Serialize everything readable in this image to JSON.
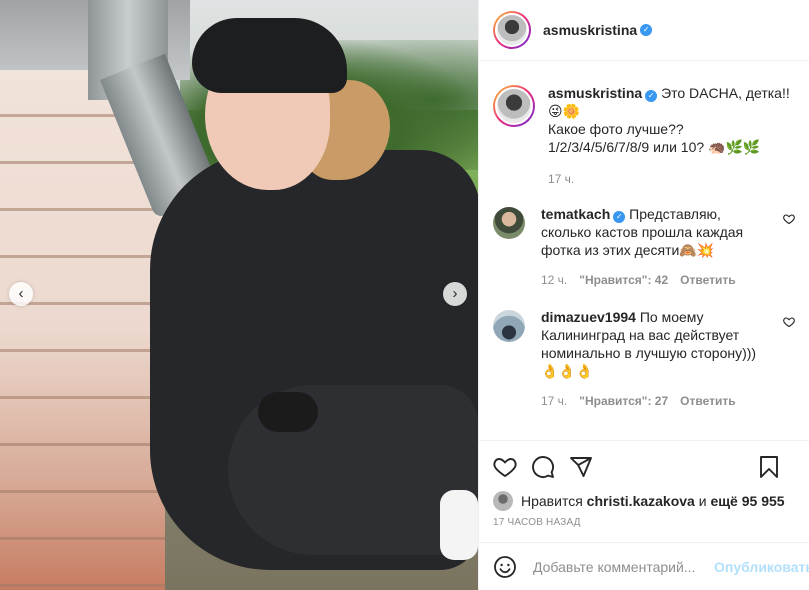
{
  "post": {
    "author": "asmuskristina",
    "verified_mark": "✓"
  },
  "caption": {
    "username": "asmuskristina",
    "line1": "Это DACHA, детка!! 😜🌼",
    "line2": "Какое фото лучше??",
    "line3": "1/2/3/4/5/6/7/8/9 или 10? 🦔🌿🌿",
    "time": "17 ч."
  },
  "comments": [
    {
      "username": "tematkach",
      "verified": true,
      "text": "Представляю, сколько кастов прошла каждая фотка из этих десяти🙈💥",
      "time": "12 ч.",
      "likes": "\"Нравится\": 42",
      "reply": "Ответить"
    },
    {
      "username": "dimazuev1994",
      "verified": false,
      "text": "По моему Калининград на вас действует номинально в лучшую сторону)))👌👌👌",
      "time": "17 ч.",
      "likes": "\"Нравится\": 27",
      "reply": "Ответить"
    }
  ],
  "likes": {
    "prefix": "Нравится",
    "user": "christi.kazakova",
    "suffix": "и",
    "others": "ещё 95 955"
  },
  "timestamp": "17 ЧАСОВ НАЗАД",
  "add_comment": {
    "placeholder": "Добавьте комментарий...",
    "post_label": "Опубликовать"
  },
  "carousel": {
    "prev": "‹",
    "next": "›"
  },
  "icons": {
    "actions": [
      "heart-icon",
      "comment-icon",
      "share-icon",
      "bookmark-icon"
    ],
    "composer": "emoji-icon"
  },
  "colors": {
    "verified": "#3897f0",
    "post_disabled": "#b2dffc",
    "meta": "#8e8e8e"
  }
}
